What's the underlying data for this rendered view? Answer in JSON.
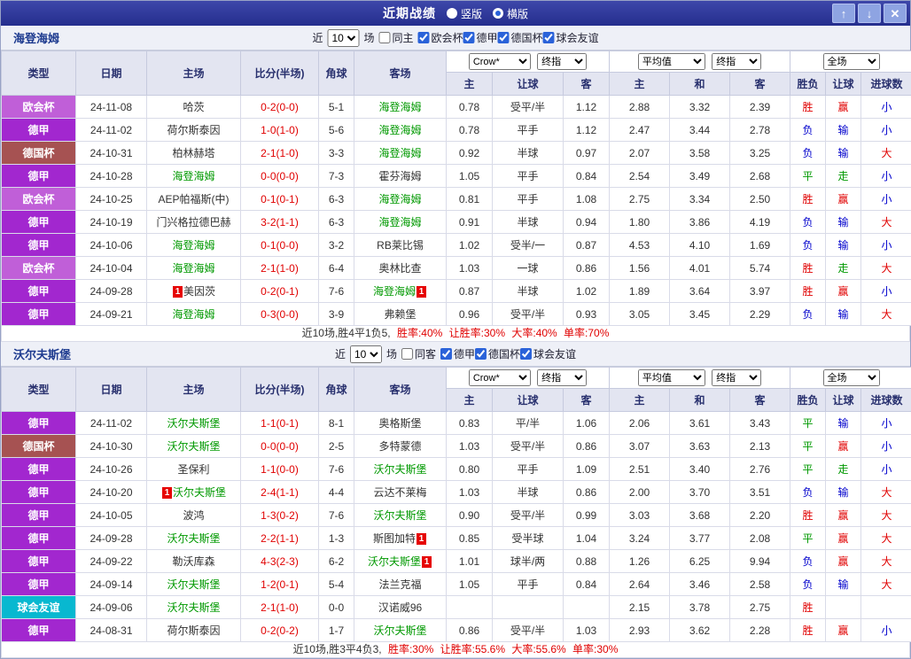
{
  "topbar": {
    "title": "近期战绩",
    "radios": [
      {
        "label": "竖版",
        "selected": false
      },
      {
        "label": "横版",
        "selected": true
      }
    ],
    "buttons": {
      "up": "↑",
      "down": "↓",
      "close": "✕"
    }
  },
  "colors": {
    "team_highlight": "#009900",
    "score": "#e00000",
    "default_text": "#333333"
  },
  "league_colors": {
    "欧会杯": "#c05fd8",
    "德甲": "#a227cf",
    "德国杯": "#a65252",
    "球会友谊": "#08b8d0"
  },
  "result_colors": {
    "胜": "#e00000",
    "平": "#009900",
    "负": "#0000cc",
    "赢": "#e00000",
    "走": "#009900",
    "输": "#0000cc",
    "大": "#e00000",
    "小": "#0000cc"
  },
  "headers": {
    "type": "类型",
    "date": "日期",
    "home": "主场",
    "score": "比分(半场)",
    "corner": "角球",
    "away": "客场",
    "asia_home": "主",
    "asia_handicap": "让球",
    "asia_away": "客",
    "euro_home": "主",
    "euro_draw": "和",
    "euro_away": "客",
    "res_outcome": "胜负",
    "res_handicap": "让球",
    "res_goals": "进球数"
  },
  "sections": [
    {
      "team": "海登海姆",
      "controls": {
        "near_label": "近",
        "count": "10",
        "games_label": "场",
        "venue_label": "同主",
        "venue_checked": false,
        "leagues": [
          {
            "label": "欧会杯",
            "checked": true
          },
          {
            "label": "德甲",
            "checked": true
          },
          {
            "label": "德国杯",
            "checked": true
          },
          {
            "label": "球会友谊",
            "checked": true
          }
        ]
      },
      "selects": {
        "source": "Crow*",
        "final1": "终指",
        "avg": "平均值",
        "final2": "终指",
        "scope": "全场"
      },
      "rows": [
        {
          "league": "欧会杯",
          "date": "24-11-08",
          "home": "哈茨",
          "home_hl": false,
          "home_red": "",
          "score": "0-2(0-0)",
          "corner": "5-1",
          "away": "海登海姆",
          "away_hl": true,
          "away_red": "",
          "ah": "0.78",
          "hd": "受平/半",
          "aa": "1.12",
          "eh": "2.88",
          "ed": "3.32",
          "ea": "2.39",
          "res": "胜",
          "hres": "赢",
          "gres": "小"
        },
        {
          "league": "德甲",
          "date": "24-11-02",
          "home": "荷尔斯泰因",
          "home_hl": false,
          "home_red": "",
          "score": "1-0(1-0)",
          "corner": "5-6",
          "away": "海登海姆",
          "away_hl": true,
          "away_red": "",
          "ah": "0.78",
          "hd": "平手",
          "aa": "1.12",
          "eh": "2.47",
          "ed": "3.44",
          "ea": "2.78",
          "res": "负",
          "hres": "输",
          "gres": "小"
        },
        {
          "league": "德国杯",
          "date": "24-10-31",
          "home": "柏林赫塔",
          "home_hl": false,
          "home_red": "",
          "score": "2-1(1-0)",
          "corner": "3-3",
          "away": "海登海姆",
          "away_hl": true,
          "away_red": "",
          "ah": "0.92",
          "hd": "半球",
          "aa": "0.97",
          "eh": "2.07",
          "ed": "3.58",
          "ea": "3.25",
          "res": "负",
          "hres": "输",
          "gres": "大"
        },
        {
          "league": "德甲",
          "date": "24-10-28",
          "home": "海登海姆",
          "home_hl": true,
          "home_red": "",
          "score": "0-0(0-0)",
          "corner": "7-3",
          "away": "霍芬海姆",
          "away_hl": false,
          "away_red": "",
          "ah": "1.05",
          "hd": "平手",
          "aa": "0.84",
          "eh": "2.54",
          "ed": "3.49",
          "ea": "2.68",
          "res": "平",
          "hres": "走",
          "gres": "小"
        },
        {
          "league": "欧会杯",
          "date": "24-10-25",
          "home": "AEP帕福斯(中)",
          "home_hl": false,
          "home_red": "",
          "score": "0-1(0-1)",
          "corner": "6-3",
          "away": "海登海姆",
          "away_hl": true,
          "away_red": "",
          "ah": "0.81",
          "hd": "平手",
          "aa": "1.08",
          "eh": "2.75",
          "ed": "3.34",
          "ea": "2.50",
          "res": "胜",
          "hres": "赢",
          "gres": "小"
        },
        {
          "league": "德甲",
          "date": "24-10-19",
          "home": "门兴格拉德巴赫",
          "home_hl": false,
          "home_red": "",
          "score": "3-2(1-1)",
          "corner": "6-3",
          "away": "海登海姆",
          "away_hl": true,
          "away_red": "",
          "ah": "0.91",
          "hd": "半球",
          "aa": "0.94",
          "eh": "1.80",
          "ed": "3.86",
          "ea": "4.19",
          "res": "负",
          "hres": "输",
          "gres": "大"
        },
        {
          "league": "德甲",
          "date": "24-10-06",
          "home": "海登海姆",
          "home_hl": true,
          "home_red": "",
          "score": "0-1(0-0)",
          "corner": "3-2",
          "away": "RB莱比锡",
          "away_hl": false,
          "away_red": "",
          "ah": "1.02",
          "hd": "受半/一",
          "aa": "0.87",
          "eh": "4.53",
          "ed": "4.10",
          "ea": "1.69",
          "res": "负",
          "hres": "输",
          "gres": "小"
        },
        {
          "league": "欧会杯",
          "date": "24-10-04",
          "home": "海登海姆",
          "home_hl": true,
          "home_red": "",
          "score": "2-1(1-0)",
          "corner": "6-4",
          "away": "奥林比查",
          "away_hl": false,
          "away_red": "",
          "ah": "1.03",
          "hd": "一球",
          "aa": "0.86",
          "eh": "1.56",
          "ed": "4.01",
          "ea": "5.74",
          "res": "胜",
          "hres": "走",
          "gres": "大"
        },
        {
          "league": "德甲",
          "date": "24-09-28",
          "home": "美因茨",
          "home_hl": false,
          "home_red": "before",
          "score": "0-2(0-1)",
          "corner": "7-6",
          "away": "海登海姆",
          "away_hl": true,
          "away_red": "after",
          "ah": "0.87",
          "hd": "半球",
          "aa": "1.02",
          "eh": "1.89",
          "ed": "3.64",
          "ea": "3.97",
          "res": "胜",
          "hres": "赢",
          "gres": "小"
        },
        {
          "league": "德甲",
          "date": "24-09-21",
          "home": "海登海姆",
          "home_hl": true,
          "home_red": "",
          "score": "0-3(0-0)",
          "corner": "3-9",
          "away": "弗赖堡",
          "away_hl": false,
          "away_red": "",
          "ah": "0.96",
          "hd": "受平/半",
          "aa": "0.93",
          "eh": "3.05",
          "ed": "3.45",
          "ea": "2.29",
          "res": "负",
          "hres": "输",
          "gres": "大"
        }
      ],
      "summary": [
        {
          "text": "近10场,胜4平1负5, ",
          "color": "#333333"
        },
        {
          "text": "胜率:40%",
          "color": "#e00000"
        },
        {
          "text": " 让胜率:30%",
          "color": "#e00000"
        },
        {
          "text": " 大率:40%",
          "color": "#e00000"
        },
        {
          "text": " 单率:70%",
          "color": "#e00000"
        }
      ]
    },
    {
      "team": "沃尔夫斯堡",
      "controls": {
        "near_label": "近",
        "count": "10",
        "games_label": "场",
        "venue_label": "同客",
        "venue_checked": false,
        "leagues": [
          {
            "label": "德甲",
            "checked": true
          },
          {
            "label": "德国杯",
            "checked": true
          },
          {
            "label": "球会友谊",
            "checked": true
          }
        ]
      },
      "selects": {
        "source": "Crow*",
        "final1": "终指",
        "avg": "平均值",
        "final2": "终指",
        "scope": "全场"
      },
      "rows": [
        {
          "league": "德甲",
          "date": "24-11-02",
          "home": "沃尔夫斯堡",
          "home_hl": true,
          "home_red": "",
          "score": "1-1(0-1)",
          "corner": "8-1",
          "away": "奥格斯堡",
          "away_hl": false,
          "away_red": "",
          "ah": "0.83",
          "hd": "平/半",
          "aa": "1.06",
          "eh": "2.06",
          "ed": "3.61",
          "ea": "3.43",
          "res": "平",
          "hres": "输",
          "gres": "小"
        },
        {
          "league": "德国杯",
          "date": "24-10-30",
          "home": "沃尔夫斯堡",
          "home_hl": true,
          "home_red": "",
          "score": "0-0(0-0)",
          "corner": "2-5",
          "away": "多特蒙德",
          "away_hl": false,
          "away_red": "",
          "ah": "1.03",
          "hd": "受平/半",
          "aa": "0.86",
          "eh": "3.07",
          "ed": "3.63",
          "ea": "2.13",
          "res": "平",
          "hres": "赢",
          "gres": "小"
        },
        {
          "league": "德甲",
          "date": "24-10-26",
          "home": "圣保利",
          "home_hl": false,
          "home_red": "",
          "score": "1-1(0-0)",
          "corner": "7-6",
          "away": "沃尔夫斯堡",
          "away_hl": true,
          "away_red": "",
          "ah": "0.80",
          "hd": "平手",
          "aa": "1.09",
          "eh": "2.51",
          "ed": "3.40",
          "ea": "2.76",
          "res": "平",
          "hres": "走",
          "gres": "小"
        },
        {
          "league": "德甲",
          "date": "24-10-20",
          "home": "沃尔夫斯堡",
          "home_hl": true,
          "home_red": "before",
          "score": "2-4(1-1)",
          "corner": "4-4",
          "away": "云达不莱梅",
          "away_hl": false,
          "away_red": "",
          "ah": "1.03",
          "hd": "半球",
          "aa": "0.86",
          "eh": "2.00",
          "ed": "3.70",
          "ea": "3.51",
          "res": "负",
          "hres": "输",
          "gres": "大"
        },
        {
          "league": "德甲",
          "date": "24-10-05",
          "home": "波鸿",
          "home_hl": false,
          "home_red": "",
          "score": "1-3(0-2)",
          "corner": "7-6",
          "away": "沃尔夫斯堡",
          "away_hl": true,
          "away_red": "",
          "ah": "0.90",
          "hd": "受平/半",
          "aa": "0.99",
          "eh": "3.03",
          "ed": "3.68",
          "ea": "2.20",
          "res": "胜",
          "hres": "赢",
          "gres": "大"
        },
        {
          "league": "德甲",
          "date": "24-09-28",
          "home": "沃尔夫斯堡",
          "home_hl": true,
          "home_red": "",
          "score": "2-2(1-1)",
          "corner": "1-3",
          "away": "斯图加特",
          "away_hl": false,
          "away_red": "after",
          "ah": "0.85",
          "hd": "受半球",
          "aa": "1.04",
          "eh": "3.24",
          "ed": "3.77",
          "ea": "2.08",
          "res": "平",
          "hres": "赢",
          "gres": "大"
        },
        {
          "league": "德甲",
          "date": "24-09-22",
          "home": "勒沃库森",
          "home_hl": false,
          "home_red": "",
          "score": "4-3(2-3)",
          "corner": "6-2",
          "away": "沃尔夫斯堡",
          "away_hl": true,
          "away_red": "after",
          "ah": "1.01",
          "hd": "球半/两",
          "aa": "0.88",
          "eh": "1.26",
          "ed": "6.25",
          "ea": "9.94",
          "res": "负",
          "hres": "赢",
          "gres": "大"
        },
        {
          "league": "德甲",
          "date": "24-09-14",
          "home": "沃尔夫斯堡",
          "home_hl": true,
          "home_red": "",
          "score": "1-2(0-1)",
          "corner": "5-4",
          "away": "法兰克福",
          "away_hl": false,
          "away_red": "",
          "ah": "1.05",
          "hd": "平手",
          "aa": "0.84",
          "eh": "2.64",
          "ed": "3.46",
          "ea": "2.58",
          "res": "负",
          "hres": "输",
          "gres": "大"
        },
        {
          "league": "球会友谊",
          "date": "24-09-06",
          "home": "沃尔夫斯堡",
          "home_hl": true,
          "home_red": "",
          "score": "2-1(1-0)",
          "corner": "0-0",
          "away": "汉诺威96",
          "away_hl": false,
          "away_red": "",
          "ah": "",
          "hd": "",
          "aa": "",
          "eh": "2.15",
          "ed": "3.78",
          "ea": "2.75",
          "res": "胜",
          "hres": "",
          "gres": ""
        },
        {
          "league": "德甲",
          "date": "24-08-31",
          "home": "荷尔斯泰因",
          "home_hl": false,
          "home_red": "",
          "score": "0-2(0-2)",
          "corner": "1-7",
          "away": "沃尔夫斯堡",
          "away_hl": true,
          "away_red": "",
          "ah": "0.86",
          "hd": "受平/半",
          "aa": "1.03",
          "eh": "2.93",
          "ed": "3.62",
          "ea": "2.28",
          "res": "胜",
          "hres": "赢",
          "gres": "小"
        }
      ],
      "summary": [
        {
          "text": "近10场,胜3平4负3, ",
          "color": "#333333"
        },
        {
          "text": "胜率:30%",
          "color": "#e00000"
        },
        {
          "text": " 让胜率:55.6%",
          "color": "#e00000"
        },
        {
          "text": " 大率:55.6%",
          "color": "#e00000"
        },
        {
          "text": " 单率:30%",
          "color": "#e00000"
        }
      ]
    }
  ]
}
